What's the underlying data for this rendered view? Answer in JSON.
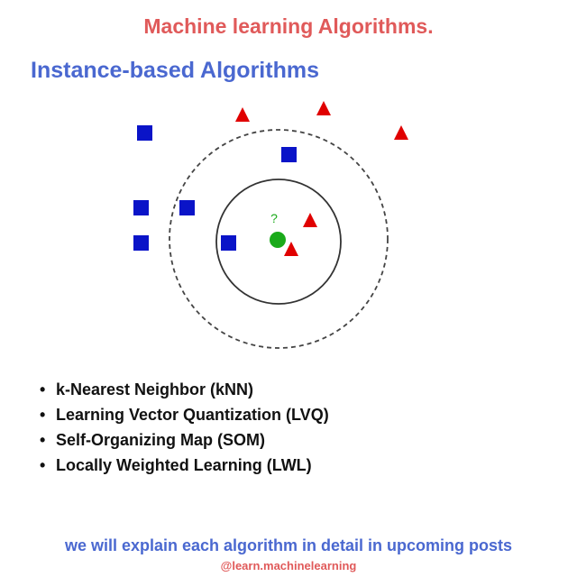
{
  "header": {
    "title": "Machine learning Algorithms."
  },
  "section": {
    "title": "Instance-based Algorithms"
  },
  "diagram": {
    "query_label": "?",
    "colors": {
      "class_square": "#0a14c8",
      "class_triangle": "#e00000",
      "query_point": "#1aaa1a",
      "query_label": "#1aaa1a",
      "inner_circle": "#333333",
      "outer_circle": "#444444"
    },
    "icons": {
      "square": "blue-square-icon",
      "triangle": "red-triangle-icon",
      "query": "green-circle-icon"
    }
  },
  "algorithms": [
    "k-Nearest Neighbor (kNN)",
    "Learning Vector Quantization (LVQ)",
    "Self-Organizing Map (SOM)",
    "Locally Weighted Learning (LWL)"
  ],
  "footer": {
    "note": "we will explain each algorithm in detail in upcoming posts",
    "handle": "@learn.machinelearning"
  },
  "theme": {
    "title_red": "#e05a5a",
    "title_blue": "#4a68d0"
  }
}
